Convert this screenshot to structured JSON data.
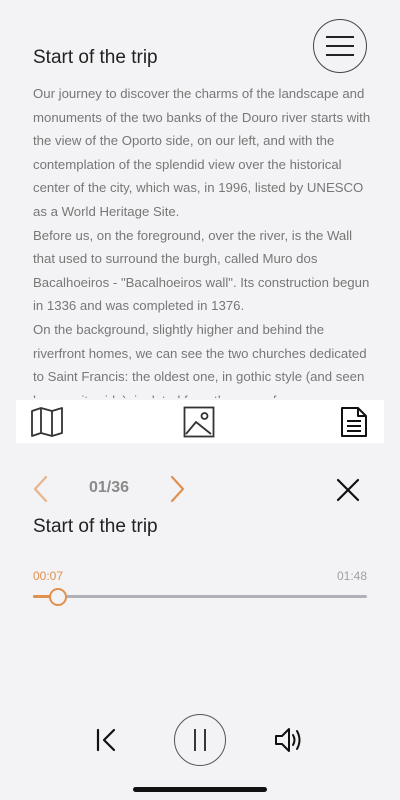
{
  "article": {
    "title": "Start of the trip",
    "paragraphs": [
      "Our journey to discover the charms of the landscape and monuments of the two banks of the Douro river starts with the view of the Oporto side, on our left, and with the contemplation of the splendid view over the historical center of the city, which was, in 1996, listed by UNESCO as a World Heritage Site.",
      "Before us, on the foreground, over the river, is the Wall that used to surround the burgh, called Muro dos Bacalhoeiros - \"Bacalhoeiros wall\". Its construction begun in 1336 and was completed in 1376.",
      "On the background, slightly higher and behind the riverfront homes, we can see the two churches dedicated to Saint Francis: the oldest one, in gothic style (and seen here on its side), is dated from the year of"
    ]
  },
  "header": {
    "menu_icon": "hamburger-menu-icon"
  },
  "tabs": [
    {
      "name": "map",
      "icon": "map-icon",
      "active": false
    },
    {
      "name": "image",
      "icon": "image-icon",
      "active": false
    },
    {
      "name": "text",
      "icon": "document-icon",
      "active": true
    }
  ],
  "player": {
    "counter": "01/36",
    "track_title": "Start of the trip",
    "time_elapsed": "00:07",
    "time_total": "01:48",
    "progress_fraction": 0.075
  },
  "colors": {
    "accent": "#e0914f",
    "prev_arrow": "#e8b48a",
    "text_muted": "#777777",
    "background": "#f3f3f5"
  }
}
